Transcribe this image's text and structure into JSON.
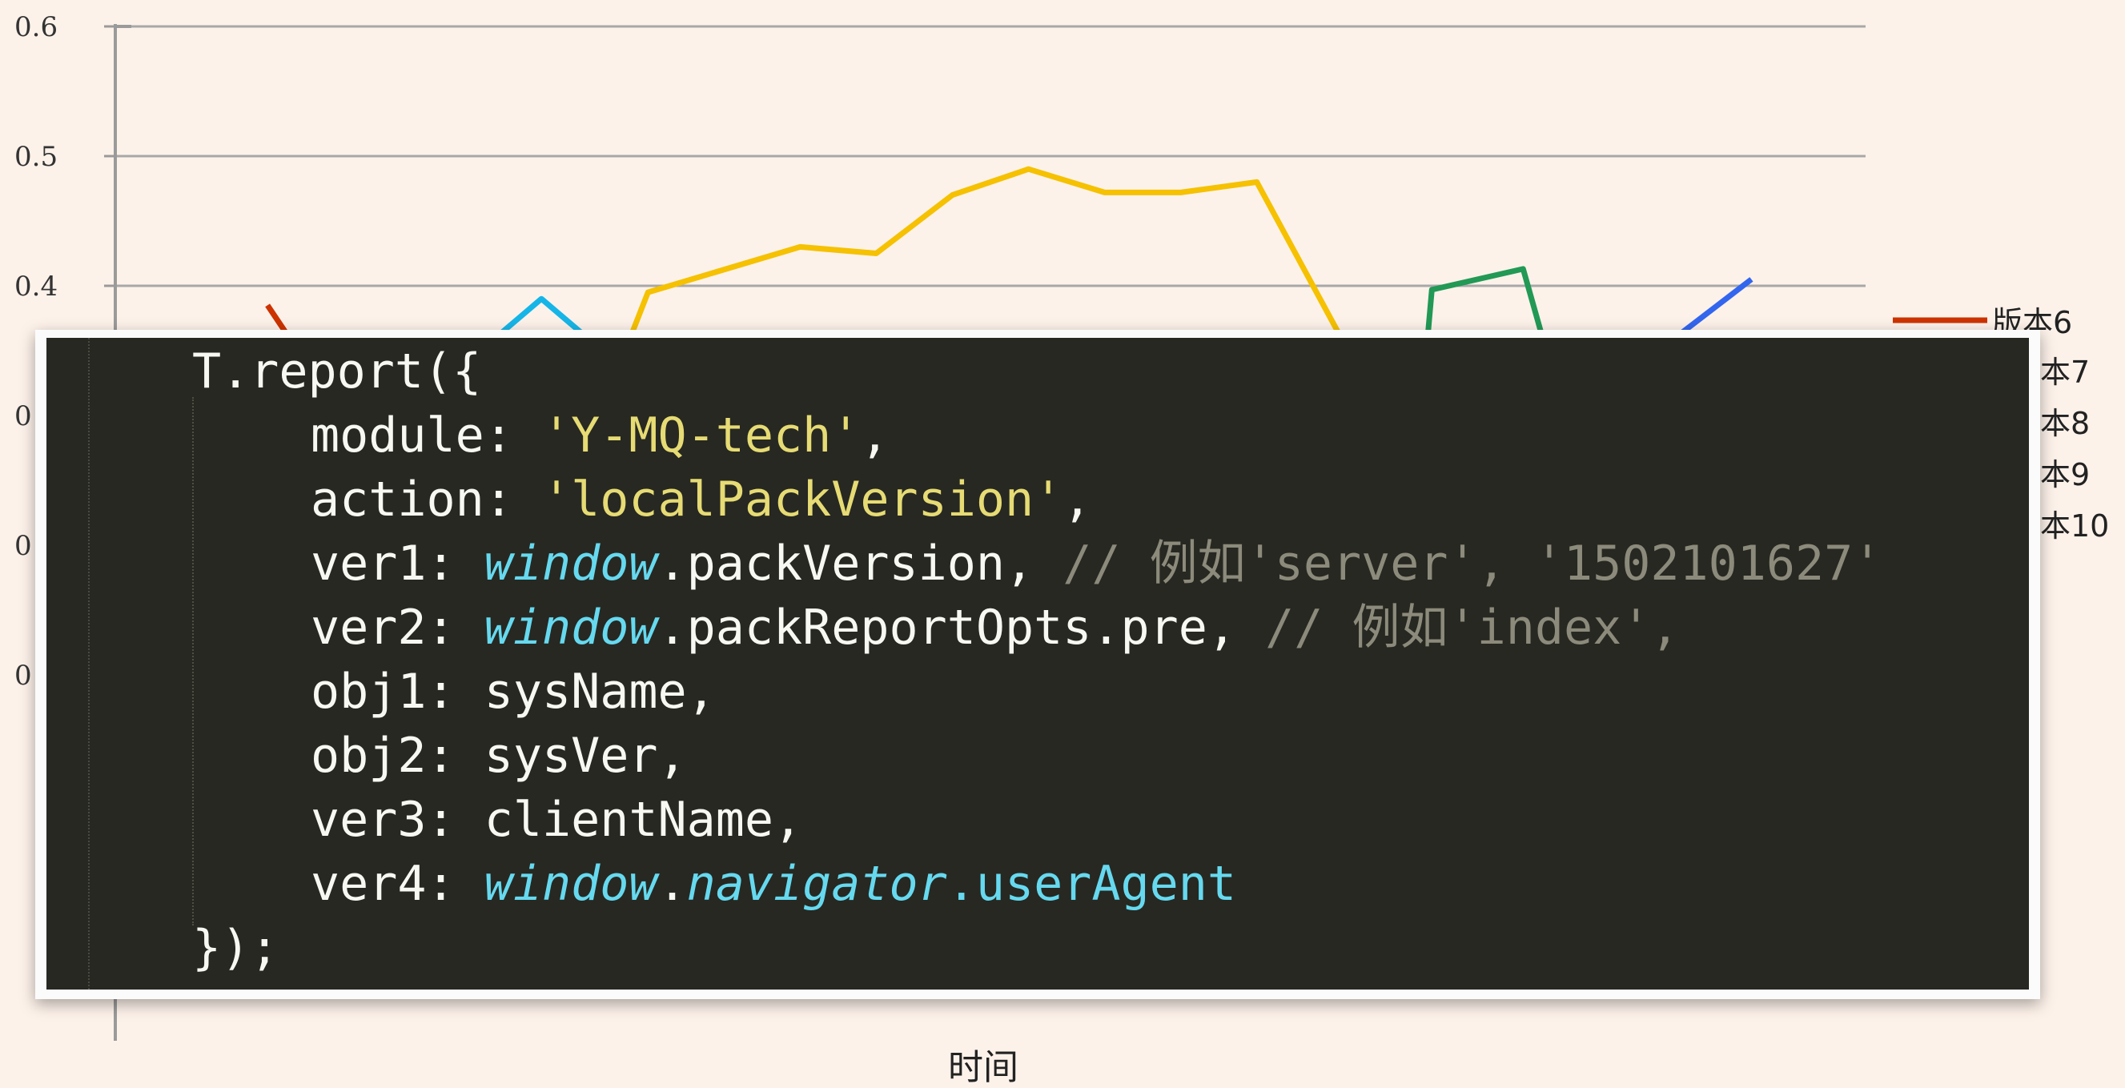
{
  "chart_data": {
    "type": "line",
    "ylim": [
      0.0,
      0.6
    ],
    "yticks": [
      "0.6",
      "0.5",
      "0.4",
      "0",
      "0",
      "0"
    ],
    "xlabel": "时间",
    "legend": [
      "版本6",
      "本7",
      "本8",
      "本9",
      "本10"
    ],
    "series": [
      {
        "name": "版本6",
        "color": "#cc3300",
        "points": [
          [
            2.0,
            0.385
          ],
          [
            2.4,
            0.35
          ]
        ]
      },
      {
        "name": "本7",
        "color": "#16b5e8",
        "points": [
          [
            5.0,
            0.36
          ],
          [
            5.6,
            0.39
          ],
          [
            6.2,
            0.36
          ]
        ]
      },
      {
        "name": "本8",
        "color": "#f5c100",
        "points": [
          [
            6.7,
            0.35
          ],
          [
            7.0,
            0.395
          ],
          [
            9.0,
            0.43
          ],
          [
            10.0,
            0.425
          ],
          [
            11.0,
            0.47
          ],
          [
            12.0,
            0.49
          ],
          [
            13.0,
            0.472
          ],
          [
            14.0,
            0.472
          ],
          [
            15.0,
            0.48
          ],
          [
            16.2,
            0.35
          ]
        ]
      },
      {
        "name": "本9",
        "color": "#229955",
        "points": [
          [
            17.2,
            0.33
          ],
          [
            17.3,
            0.397
          ],
          [
            18.5,
            0.413
          ],
          [
            18.9,
            0.33
          ]
        ]
      },
      {
        "name": "本10",
        "color": "#3366ee",
        "points": [
          [
            20.5,
            0.36
          ],
          [
            21.5,
            0.405
          ]
        ]
      }
    ]
  },
  "code": {
    "line1": "T.report({",
    "module_key": "module: ",
    "module_val": "'Y-MQ-tech'",
    "action_key": "action: ",
    "action_val": "'localPackVersion'",
    "ver1_key": "ver1: ",
    "ver1_obj": "window",
    "ver1_rest": ".packVersion, ",
    "ver1_cmt": "// 例如'server', '1502101627'",
    "ver2_key": "ver2: ",
    "ver2_obj": "window",
    "ver2_rest": ".packReportOpts.pre, ",
    "ver2_cmt": "// 例如'index',",
    "obj1": "obj1: sysName,",
    "obj2": "obj2: sysVer,",
    "ver3": "ver3: clientName,",
    "ver4_key": "ver4: ",
    "ver4_obj": "window",
    "ver4_dot": ".",
    "ver4_nav": "navigator",
    "ver4_ua": ".userAgent",
    "close": "});"
  }
}
